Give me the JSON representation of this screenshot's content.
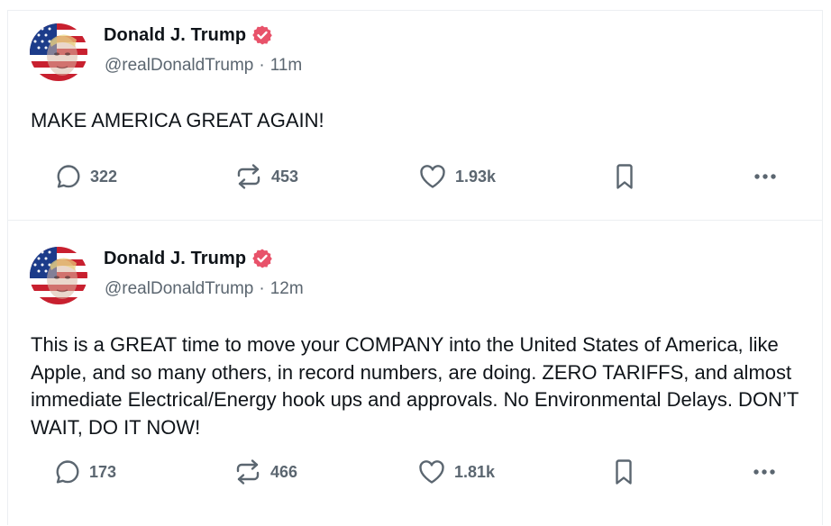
{
  "posts": [
    {
      "author": {
        "name": "Donald J. Trump",
        "handle": "@realDonaldTrump",
        "time": "11m",
        "verified": true
      },
      "text": "MAKE AMERICA GREAT AGAIN!",
      "counts": {
        "replies": "322",
        "retruths": "453",
        "likes": "1.93k"
      }
    },
    {
      "author": {
        "name": "Donald J. Trump",
        "handle": "@realDonaldTrump",
        "time": "12m",
        "verified": true
      },
      "text": "This is a GREAT time to move your COMPANY into the United States of America, like Apple, and so many others, in record numbers, are doing. ZERO TARIFFS, and almost immediate Electrical/Energy hook ups and approvals. No Environmental Delays. DON’T WAIT, DO IT NOW!",
      "counts": {
        "replies": "173",
        "retruths": "466",
        "likes": "1.81k"
      }
    }
  ],
  "meta_separator": "·",
  "colors": {
    "text": "#0f1419",
    "muted": "#5b6670",
    "verified_badge": "#e8526a",
    "divider": "#eceff2",
    "avatar_red": "#c8202f",
    "avatar_blue": "#1c3c8a"
  },
  "icons": {
    "reply": "speech-bubble-icon",
    "retruth": "repost-arrows-icon",
    "like": "heart-icon",
    "bookmark": "bookmark-icon",
    "more": "ellipsis-icon",
    "verified": "verified-badge-icon"
  }
}
